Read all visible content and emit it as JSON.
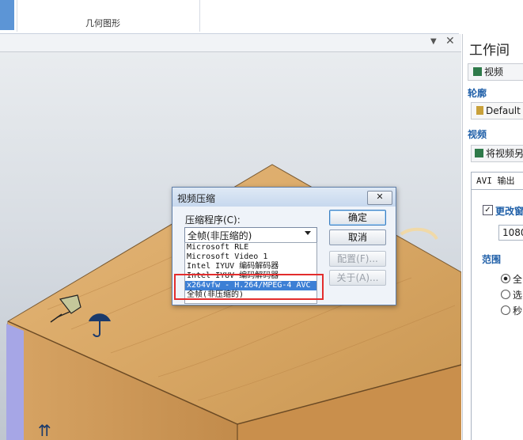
{
  "ribbon": {
    "group_label": "几何图形"
  },
  "viewport": {
    "pin_icon": "▼",
    "pin2_icon": "✕"
  },
  "panel": {
    "title": "工作间",
    "view_btn": "视频",
    "outline_label": "轮廓",
    "default_btn": "Default",
    "video_label": "视频",
    "export_btn": "将视频另",
    "tab_avi": "AVI 输出",
    "checkbox_label": "更改窗",
    "width_value": "1080",
    "range_label": "范围",
    "radio1": "全",
    "radio2": "选",
    "radio3": "秒"
  },
  "dialog": {
    "title": "视频压缩",
    "close": "✕",
    "compressor_label": "压缩程序(C):",
    "selected_value": "全帧(非压缩的)",
    "codecs": [
      "Microsoft RLE",
      "Microsoft Video 1",
      "Intel IYUV 编码解码器",
      "Intel IYUV 编码解码器",
      "x264vfw - H.264/MPEG-4 AVC",
      "全帧(非压缩的)"
    ],
    "selected_index": 4,
    "ok": "确定",
    "cancel": "取消",
    "config": "配置(F)...",
    "about": "关于(A)..."
  },
  "colors": {
    "accent": "#3c7fd5",
    "highlight": "#e32d2d",
    "wood": "#d9a866"
  }
}
